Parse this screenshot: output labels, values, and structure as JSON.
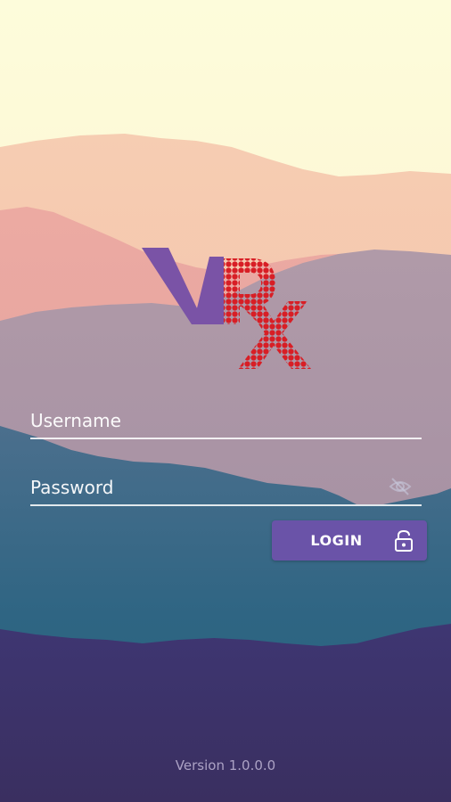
{
  "logo": {
    "letters": [
      "V",
      "R",
      "x"
    ]
  },
  "form": {
    "username_placeholder": "Username",
    "password_placeholder": "Password",
    "login_label": "LOGIN"
  },
  "footer": {
    "version": "Version 1.0.0.0"
  },
  "icons": {
    "eye": "eye-off-icon",
    "lock": "lock-open-icon"
  },
  "colors": {
    "sky": "#fdfcdc",
    "button": "#6a53a8",
    "logo_purple": "#7a53a6",
    "logo_red": "#d81e25",
    "deep_purple": "#3a2f62"
  }
}
